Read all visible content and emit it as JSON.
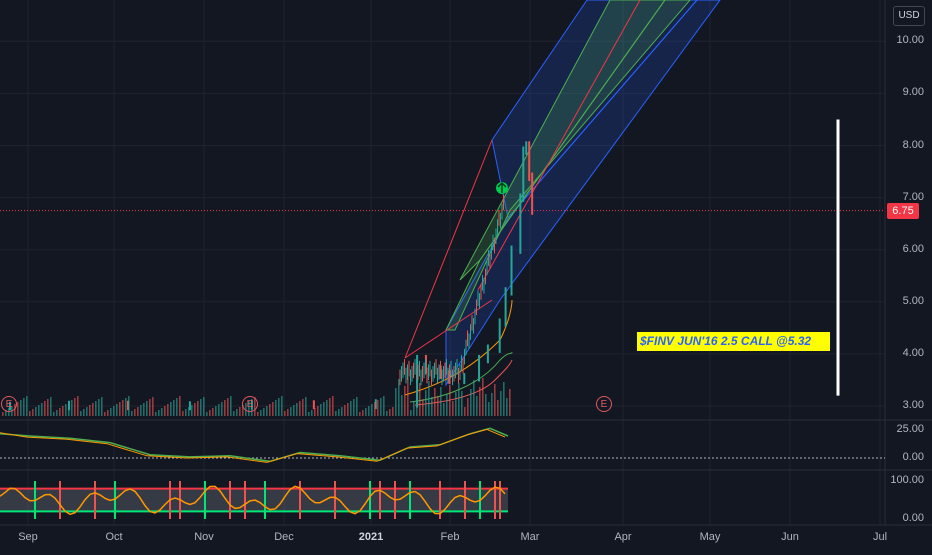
{
  "currency": "USD",
  "current_price_label": "6.75",
  "annotation_text": "$FINV JUN'16 2.5 CALL @5.32",
  "earnings_marker": "E",
  "colors": {
    "background": "#131722",
    "up": "#26a69a",
    "down": "#ef5350",
    "note_bg": "#ffff00",
    "note_text": "#2962ff",
    "price_line": "#f23645",
    "channel_blue": "#2962ff",
    "channel_green": "#4caf50",
    "channel_red": "#f23645"
  },
  "chart_data": {
    "type": "line",
    "title": "",
    "price_axis": {
      "ticks": [
        "10.00",
        "9.00",
        "8.00",
        "7.00",
        "6.00",
        "5.00",
        "4.00",
        "3.00"
      ],
      "tick_values": [
        10,
        9,
        8,
        7,
        6,
        5,
        4,
        3
      ],
      "ylim": [
        2.9,
        10.7
      ],
      "scale": "linear"
    },
    "time_axis": {
      "labels": [
        "Sep",
        "Oct",
        "Nov",
        "Dec",
        "2021",
        "Feb",
        "Mar",
        "Apr",
        "May",
        "Jun",
        "Jul"
      ],
      "bold": [
        "2021"
      ]
    },
    "series": [
      {
        "name": "",
        "type": "candles",
        "x": [
          "2020-08-26",
          "2020-09-15",
          "2020-10-05",
          "2020-10-26",
          "2020-11-16",
          "2020-12-07",
          "2020-12-28",
          "2021-01-11",
          "2021-01-14",
          "2021-01-19",
          "2021-01-22",
          "2021-01-27",
          "2021-02-01",
          "2021-02-04",
          "2021-02-08",
          "2021-02-10",
          "2021-02-12",
          "2021-02-15",
          "2021-02-16",
          "2021-02-17",
          "2021-02-18",
          "2021-02-19"
        ],
        "close": [
          3.0,
          3.02,
          3.0,
          3.01,
          3.03,
          3.02,
          3.05,
          3.9,
          3.7,
          3.6,
          3.5,
          3.55,
          3.9,
          4.1,
          4.6,
          5.2,
          6.0,
          7.0,
          7.9,
          8.0,
          7.4,
          6.75
        ]
      }
    ],
    "current_price": 6.75,
    "channel": {
      "upper_start": [
        7.95,
        "2021-02-15"
      ],
      "note": "regression channel drawn from mid-Jan 2021 projecting upward into Mar 2021"
    },
    "vertical_marker_range": [
      3.2,
      8.5
    ],
    "indicators": [
      {
        "name": "",
        "ticks": [
          "25.00",
          "0.00"
        ],
        "tick_values": [
          25,
          0
        ]
      },
      {
        "name": "",
        "ticks": [
          "100.00",
          "0.00"
        ],
        "tick_values": [
          100,
          0
        ]
      }
    ]
  }
}
